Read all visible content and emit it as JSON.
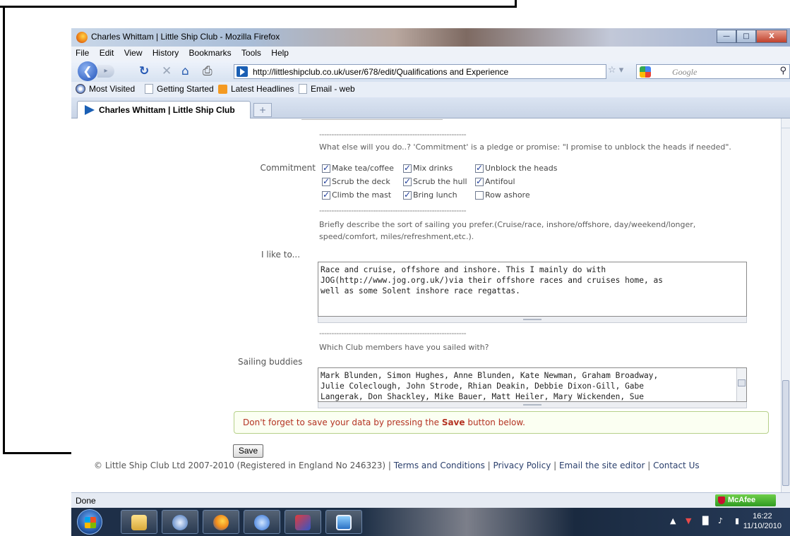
{
  "browser": {
    "window_title": "Charles Whittam | Little Ship Club - Mozilla Firefox",
    "menu": [
      "File",
      "Edit",
      "View",
      "History",
      "Bookmarks",
      "Tools",
      "Help"
    ],
    "url": "http://littleshipclub.co.uk/user/678/edit/Qualifications and Experience",
    "search_placeholder": "Google",
    "bookmarks": [
      "Most Visited",
      "Getting Started",
      "Latest Headlines",
      "Email - web"
    ],
    "tab_title": "Charles Whittam | Little Ship Club",
    "new_tab": "+",
    "status": "Done",
    "mcafee": "McAfee"
  },
  "form": {
    "divider": "------------------------------------------------------------",
    "commitment_desc": "What else will you do..? 'Commitment' is a pledge or promise: \"I promise to unblock the heads if needed\".",
    "commitment_label": "Commitment",
    "commitments": [
      {
        "label": "Make tea/coffee",
        "checked": true
      },
      {
        "label": "Mix drinks",
        "checked": true
      },
      {
        "label": "Unblock the heads",
        "checked": true
      },
      {
        "label": "Scrub the deck",
        "checked": true
      },
      {
        "label": "Scrub the hull",
        "checked": true
      },
      {
        "label": "Antifoul",
        "checked": true
      },
      {
        "label": "Climb the mast",
        "checked": true
      },
      {
        "label": "Bring lunch",
        "checked": true
      },
      {
        "label": "Row ashore",
        "checked": false
      }
    ],
    "sailing_desc_1": "Briefly describe the sort of sailing you prefer.(Cruise/race, inshore/offshore, day/weekend/longer,",
    "sailing_desc_2": "speed/comfort, miles/refreshment,etc.).",
    "ilike_label": "I like to...",
    "ilike_value": "Race and cruise, offshore and inshore. This I mainly do with\nJOG(http://www.jog.org.uk/)via their offshore races and cruises home, as\nwell as some Solent inshore race regattas.",
    "buddies_desc": "Which Club members have you sailed with?",
    "buddies_label": "Sailing buddies",
    "buddies_value": "Mark Blunden, Simon Hughes, Anne Blunden, Kate Newman, Graham Broadway,\nJulie Coleclough, John Strode, Rhian Deakin, Debbie Dixon-Gill, Gabe\nLangerak, Don Shackley, Mike Bauer, Matt Heiler, Mary Wickenden, Sue",
    "notice_pre": "Don't forget to save your data by pressing the ",
    "notice_bold": "Save",
    "notice_post": " button below.",
    "save_label": "Save"
  },
  "footer": {
    "copyright": "© Little Ship Club Ltd 2007-2010 (Registered in England No 246323) | ",
    "links": [
      "Terms and Conditions",
      "Privacy Policy",
      "Email the site editor",
      "Contact Us"
    ],
    "sep": " | "
  },
  "taskbar": {
    "time": "16:22",
    "date": "11/10/2010"
  }
}
